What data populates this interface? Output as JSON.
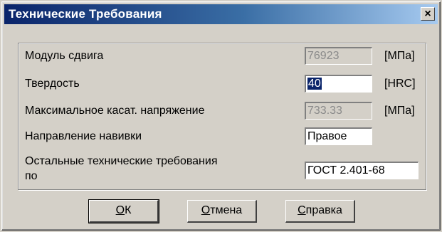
{
  "window": {
    "title": "Технические Требования",
    "close_glyph": "×"
  },
  "rows": [
    {
      "label": "Модуль сдвига",
      "value": "76923",
      "unit": "[МПа]"
    },
    {
      "label": "Твердость",
      "value": "40",
      "unit": "[HRC]"
    },
    {
      "label": "Максимальное касат. напряжение",
      "value": "733.33",
      "unit": "[МПа]"
    },
    {
      "label": "Направление навивки",
      "value": "Правое"
    },
    {
      "label_line1": "Остальные технические требования",
      "label_line2": "по",
      "value": "ГОСТ 2.401-68"
    }
  ],
  "buttons": {
    "ok": {
      "accel": "О",
      "rest": "К"
    },
    "cancel": {
      "accel": "О",
      "rest": "тмена"
    },
    "help": {
      "accel": "С",
      "rest": "правка"
    }
  },
  "colors": {
    "title_start": "#0a246a",
    "title_end": "#a6caf0",
    "face": "#d4d0c8",
    "selection": "#0a246a"
  }
}
